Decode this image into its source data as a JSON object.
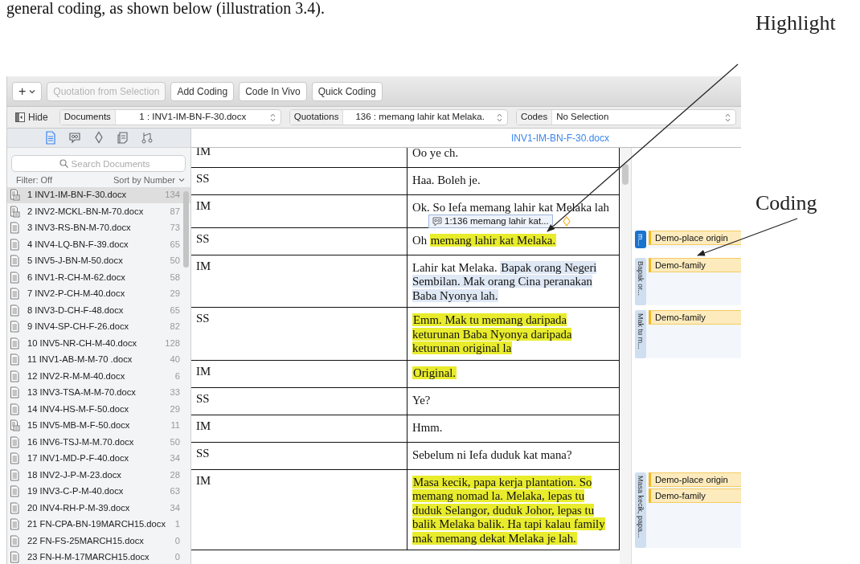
{
  "caption": "general coding, as shown below (illustration 3.4).",
  "callouts": [
    {
      "label": "Highlight"
    },
    {
      "label": "Coding"
    }
  ],
  "toolbar": {
    "add_menu": "+",
    "buttons": [
      {
        "label": "Quotation from Selection",
        "disabled": true
      },
      {
        "label": "Add Coding",
        "disabled": false
      },
      {
        "label": "Code In Vivo",
        "disabled": false
      },
      {
        "label": "Quick Coding",
        "disabled": false
      }
    ]
  },
  "navigator": {
    "hide": "Hide",
    "selectors": [
      {
        "label": "Documents",
        "value": "1 : INV1-IM-BN-F-30.docx"
      },
      {
        "label": "Quotations",
        "value": "136 : memang lahir kat Melaka."
      },
      {
        "label": "Codes",
        "value": "No Selection"
      }
    ]
  },
  "sidebar": {
    "tabs": [
      {
        "kind": "documents",
        "selected": true
      },
      {
        "kind": "quotations",
        "selected": false
      },
      {
        "kind": "codes",
        "selected": false
      },
      {
        "kind": "memos",
        "selected": false
      },
      {
        "kind": "networks",
        "selected": false
      }
    ],
    "search": {
      "placeholder": "Search Documents"
    },
    "filter": "Filter: Off",
    "sort": "Sort by Number",
    "documents": [
      {
        "label": "1 INV1-IM-BN-F-30.docx",
        "count": "134",
        "kind": "linked",
        "selected": true
      },
      {
        "label": "2 INV2-MCKL-BN-M-70.docx",
        "count": "87",
        "kind": "linked",
        "selected": false
      },
      {
        "label": "3 INV3-RS-BN-M-70.docx",
        "count": "73",
        "kind": "plain",
        "selected": false
      },
      {
        "label": "4 INV4-LQ-BN-F-39.docx",
        "count": "65",
        "kind": "plain",
        "selected": false
      },
      {
        "label": "5 INV5-J-BN-M-50.docx",
        "count": "50",
        "kind": "plain",
        "selected": false
      },
      {
        "label": "6 INV1-R-CH-M-62.docx",
        "count": "58",
        "kind": "plain",
        "selected": false
      },
      {
        "label": "7 INV2-P-CH-M-40.docx",
        "count": "29",
        "kind": "plain",
        "selected": false
      },
      {
        "label": "8 INV3-D-CH-F-48.docx",
        "count": "65",
        "kind": "plain",
        "selected": false
      },
      {
        "label": "9 INV4-SP-CH-F-26.docx",
        "count": "82",
        "kind": "plain",
        "selected": false
      },
      {
        "label": "10 INV5-NR-CH-M-40.docx",
        "count": "128",
        "kind": "plain",
        "selected": false
      },
      {
        "label": "11 INV1-AB-M-M-70 .docx",
        "count": "40",
        "kind": "plain",
        "selected": false
      },
      {
        "label": "12 INV2-R-M-M-40.docx",
        "count": "6",
        "kind": "plain",
        "selected": false
      },
      {
        "label": "13 INV3-TSA-M-M-70.docx",
        "count": "33",
        "kind": "plain",
        "selected": false
      },
      {
        "label": "14 INV4-HS-M-F-50.docx",
        "count": "29",
        "kind": "plain",
        "selected": false
      },
      {
        "label": "15 INV5-MB-M-F-50.docx",
        "count": "11",
        "kind": "linked",
        "selected": false
      },
      {
        "label": "16 INV6-TSJ-M-M.70.docx",
        "count": "50",
        "kind": "plain",
        "selected": false
      },
      {
        "label": "17 INV1-MD-P-F-40.docx",
        "count": "34",
        "kind": "plain",
        "selected": false
      },
      {
        "label": "18 INV2-J-P-M-23.docx",
        "count": "28",
        "kind": "plain",
        "selected": false
      },
      {
        "label": "19 INV3-C-P-M-40.docx",
        "count": "63",
        "kind": "plain",
        "selected": false
      },
      {
        "label": "20 INV4-RH-P-M-39.docx",
        "count": "34",
        "kind": "plain",
        "selected": false
      },
      {
        "label": "21 FN-CPA-BN-19MARCH15.docx",
        "count": "1",
        "kind": "plain",
        "selected": false
      },
      {
        "label": "22 FN-FS-25MARCH15.docx",
        "count": "0",
        "kind": "plain",
        "selected": false
      },
      {
        "label": "23 FN-H-M-17MARCH15.docx",
        "count": "0",
        "kind": "plain",
        "selected": false
      }
    ]
  },
  "document": {
    "title": "INV1-IM-BN-F-30.docx",
    "rows": [
      {
        "speaker": "IM",
        "segments": [
          {
            "text": "Oo ye ch."
          }
        ]
      },
      {
        "speaker": "SS",
        "segments": [
          {
            "text": "Haa. Boleh je."
          }
        ]
      },
      {
        "speaker": "IM",
        "segments": [
          {
            "text": "Ok. So Iefa memang lahir kat Melaka lah"
          }
        ],
        "tooltip": "1:136 memang lahir kat..."
      },
      {
        "speaker": "SS",
        "segments": [
          {
            "text": "Oh "
          },
          {
            "text": "memang lahir kat Melaka.",
            "color": "#e8ec2c"
          }
        ],
        "margin": {
          "quote": "m...",
          "selected": true,
          "codes": [
            "Demo-place origin"
          ]
        }
      },
      {
        "speaker": "IM",
        "segments": [
          {
            "text": "Lahir kat Melaka. "
          },
          {
            "text": "Bapak orang Negeri Sembilan. Mak orang Cina peranakan Baba Nyonya lah.",
            "color": "#dfe8f5"
          }
        ],
        "margin": {
          "quote": "Bapak or...",
          "selected": false,
          "codes": [
            "Demo-family"
          ]
        }
      },
      {
        "speaker": "SS",
        "segments": [
          {
            "text": "Emm. Mak tu memang daripada keturunan Baba Nyonya daripada keturunan original la",
            "color": "#e8ec2c"
          }
        ],
        "margin": {
          "quote": "Mak tu m...",
          "selected": false,
          "codes": [
            "Demo-family"
          ]
        }
      },
      {
        "speaker": "IM",
        "segments": [
          {
            "text": "Original.",
            "color": "#e8ec2c"
          }
        ]
      },
      {
        "speaker": "SS",
        "segments": [
          {
            "text": "Ye?"
          }
        ]
      },
      {
        "speaker": "IM",
        "segments": [
          {
            "text": "Hmm."
          }
        ]
      },
      {
        "speaker": "SS",
        "segments": [
          {
            "text": "Sebelum ni Iefa duduk kat mana?"
          }
        ]
      },
      {
        "speaker": "IM",
        "segments": [
          {
            "text": "Masa kecik, papa kerja plantation. So memang nomad la. Melaka, lepas tu duduk Selangor, duduk Johor, lepas tu balik Melaka balik. Ha tapi kalau family mak memang dekat Melaka je lah.",
            "color": "#e8ec2c"
          }
        ],
        "margin": {
          "quote": "Masa kecik, papa...",
          "selected": false,
          "codes": [
            "Demo-place origin",
            "Demo-family"
          ]
        }
      }
    ]
  }
}
